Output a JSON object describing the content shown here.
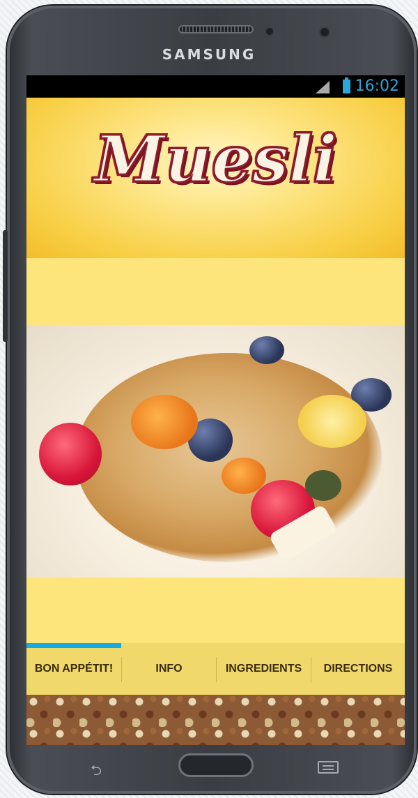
{
  "device": {
    "brand": "SAMSUNG"
  },
  "status_bar": {
    "time": "16:02"
  },
  "app": {
    "logo_text": "Muesli"
  },
  "tabs": [
    {
      "label": "BON APPÉTIT!",
      "selected": true
    },
    {
      "label": "INFO",
      "selected": false
    },
    {
      "label": "INGREDIENTS",
      "selected": false
    },
    {
      "label": "DIRECTIONS",
      "selected": false
    }
  ],
  "colors": {
    "accent": "#18a9df",
    "band": "#fde57b",
    "tab_bar": "#f0d96a",
    "logo_outline": "#8a1b2a"
  }
}
